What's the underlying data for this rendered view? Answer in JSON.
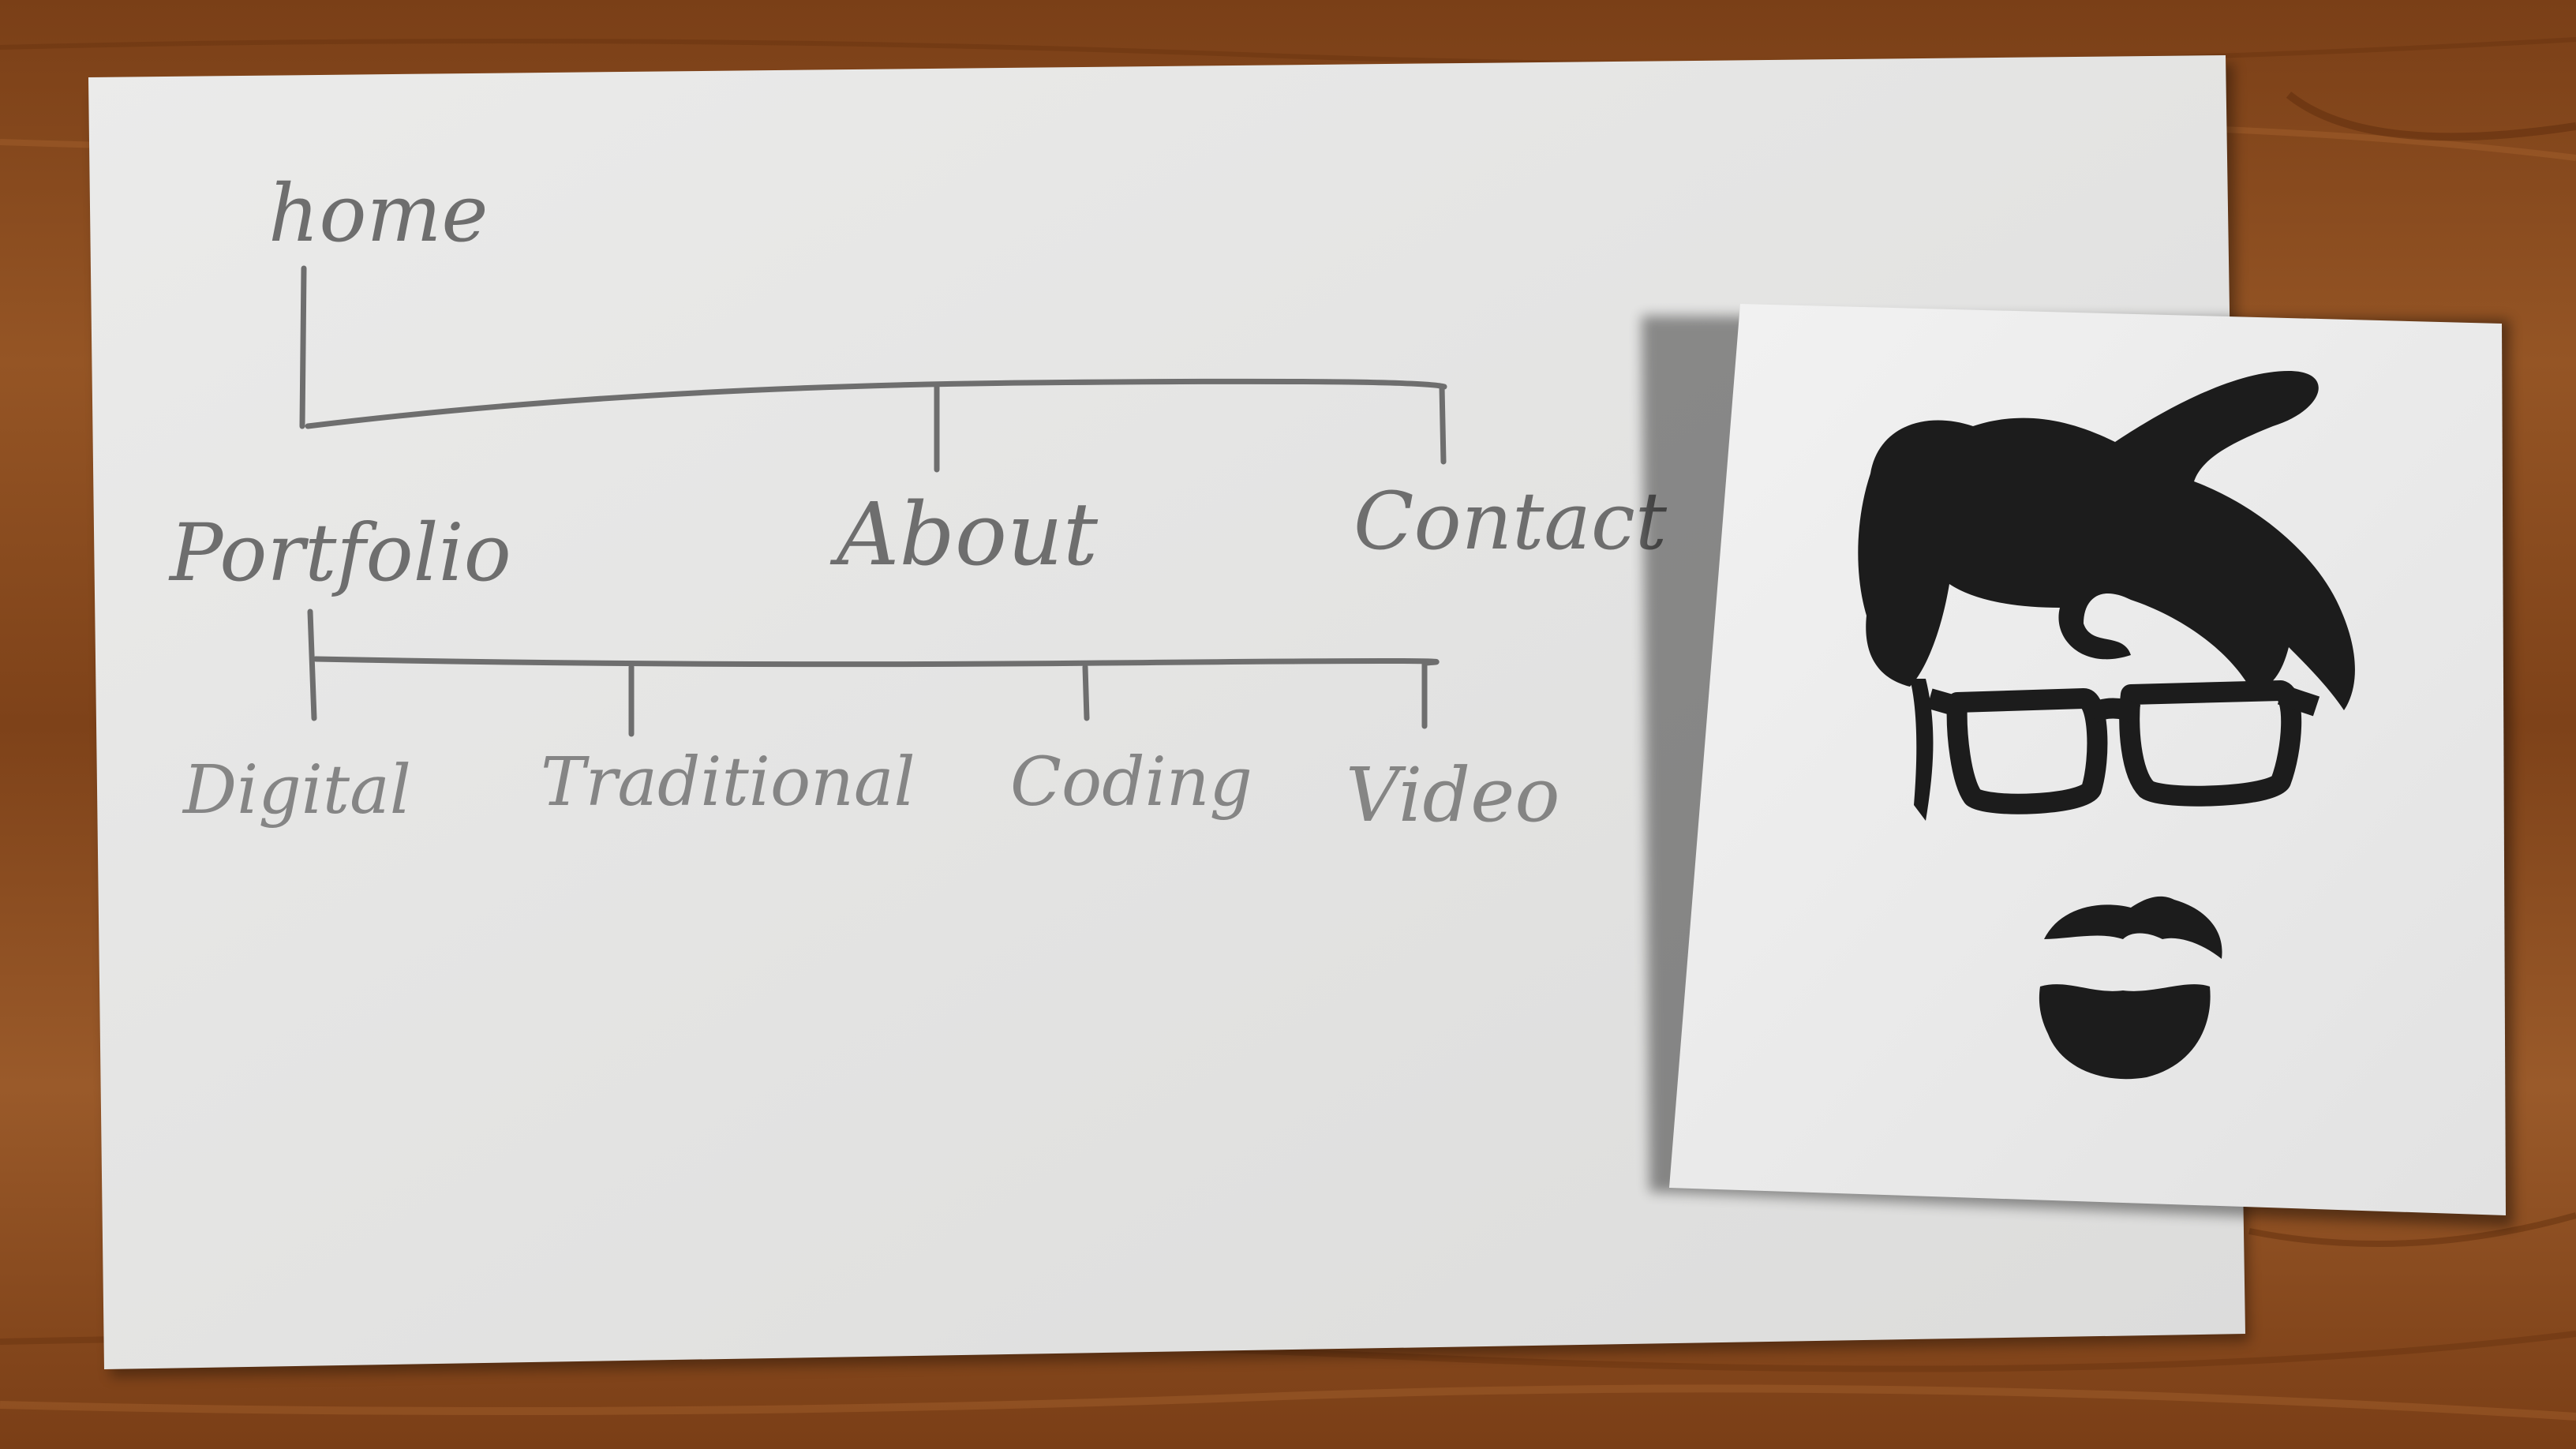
{
  "sitemap": {
    "root": "home",
    "level1": [
      "Portfolio",
      "About",
      "Contact"
    ],
    "level2": [
      "Digital",
      "Traditional",
      "Coding",
      "Video"
    ]
  },
  "colors": {
    "wood": "#8a4a1e",
    "paper": "#e6e6e6",
    "photo_card": "#ececec",
    "pencil": "#6e6e6e",
    "ink": "#1c1c1c"
  },
  "illustration": "ink-portrait-icon"
}
